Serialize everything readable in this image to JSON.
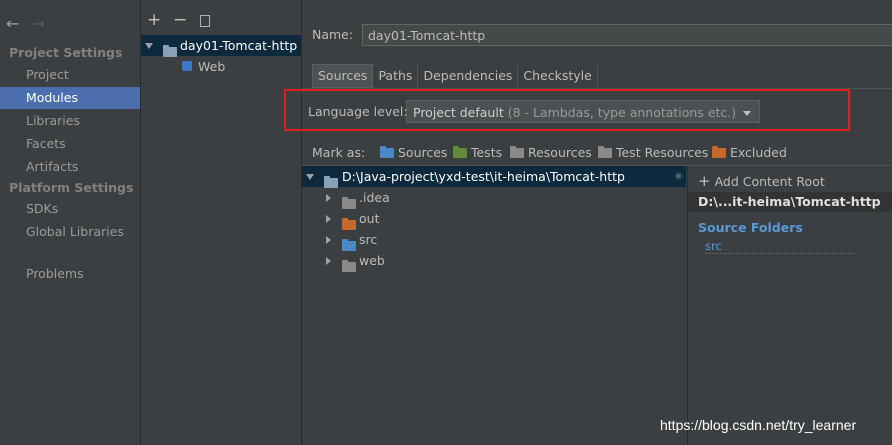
{
  "sidebar": {
    "project_settings": "Project Settings",
    "platform_settings": "Platform Settings",
    "items": [
      "Project",
      "Modules",
      "Libraries",
      "Facets",
      "Artifacts"
    ],
    "platform_items": [
      "SDKs",
      "Global Libraries"
    ],
    "problems": "Problems",
    "selected": "Modules"
  },
  "toolbar": {
    "add": "+",
    "remove": "−"
  },
  "modules": {
    "module_name": "day01-Tomcat-http",
    "facet": "Web"
  },
  "name_field": {
    "label": "Name:",
    "value": "day01-Tomcat-http"
  },
  "tabs": [
    "Sources",
    "Paths",
    "Dependencies",
    "Checkstyle"
  ],
  "language_level": {
    "label": "Language level:",
    "value_main": "Project default",
    "value_detail": "(8 - Lambdas, type annotations etc.)"
  },
  "mark_as": {
    "label": "Mark as:",
    "items": [
      {
        "label": "Sources",
        "color": "#4a88c7"
      },
      {
        "label": "Tests",
        "color": "#5f8a3a"
      },
      {
        "label": "Resources",
        "color": "#8a8a8a"
      },
      {
        "label": "Test Resources",
        "color": "#8a8a8a"
      },
      {
        "label": "Excluded",
        "color": "#c46a2e"
      }
    ]
  },
  "tree": {
    "root": "D:\\Java-project\\yxd-test\\it-heima\\Tomcat-http",
    "children": [
      {
        "label": ".idea",
        "color": "#8a8a8a"
      },
      {
        "label": "out",
        "color": "#c46a2e"
      },
      {
        "label": "src",
        "color": "#4a88c7"
      },
      {
        "label": "web",
        "color": "#8a8a8a"
      }
    ]
  },
  "right_panel": {
    "add_root": "Add Content Root",
    "root_path": "D:\\...it-heima\\Tomcat-http",
    "source_folders": "Source Folders",
    "src": "src"
  },
  "watermark": "https://blog.csdn.net/try_learner",
  "highlight_color": "#e02020"
}
